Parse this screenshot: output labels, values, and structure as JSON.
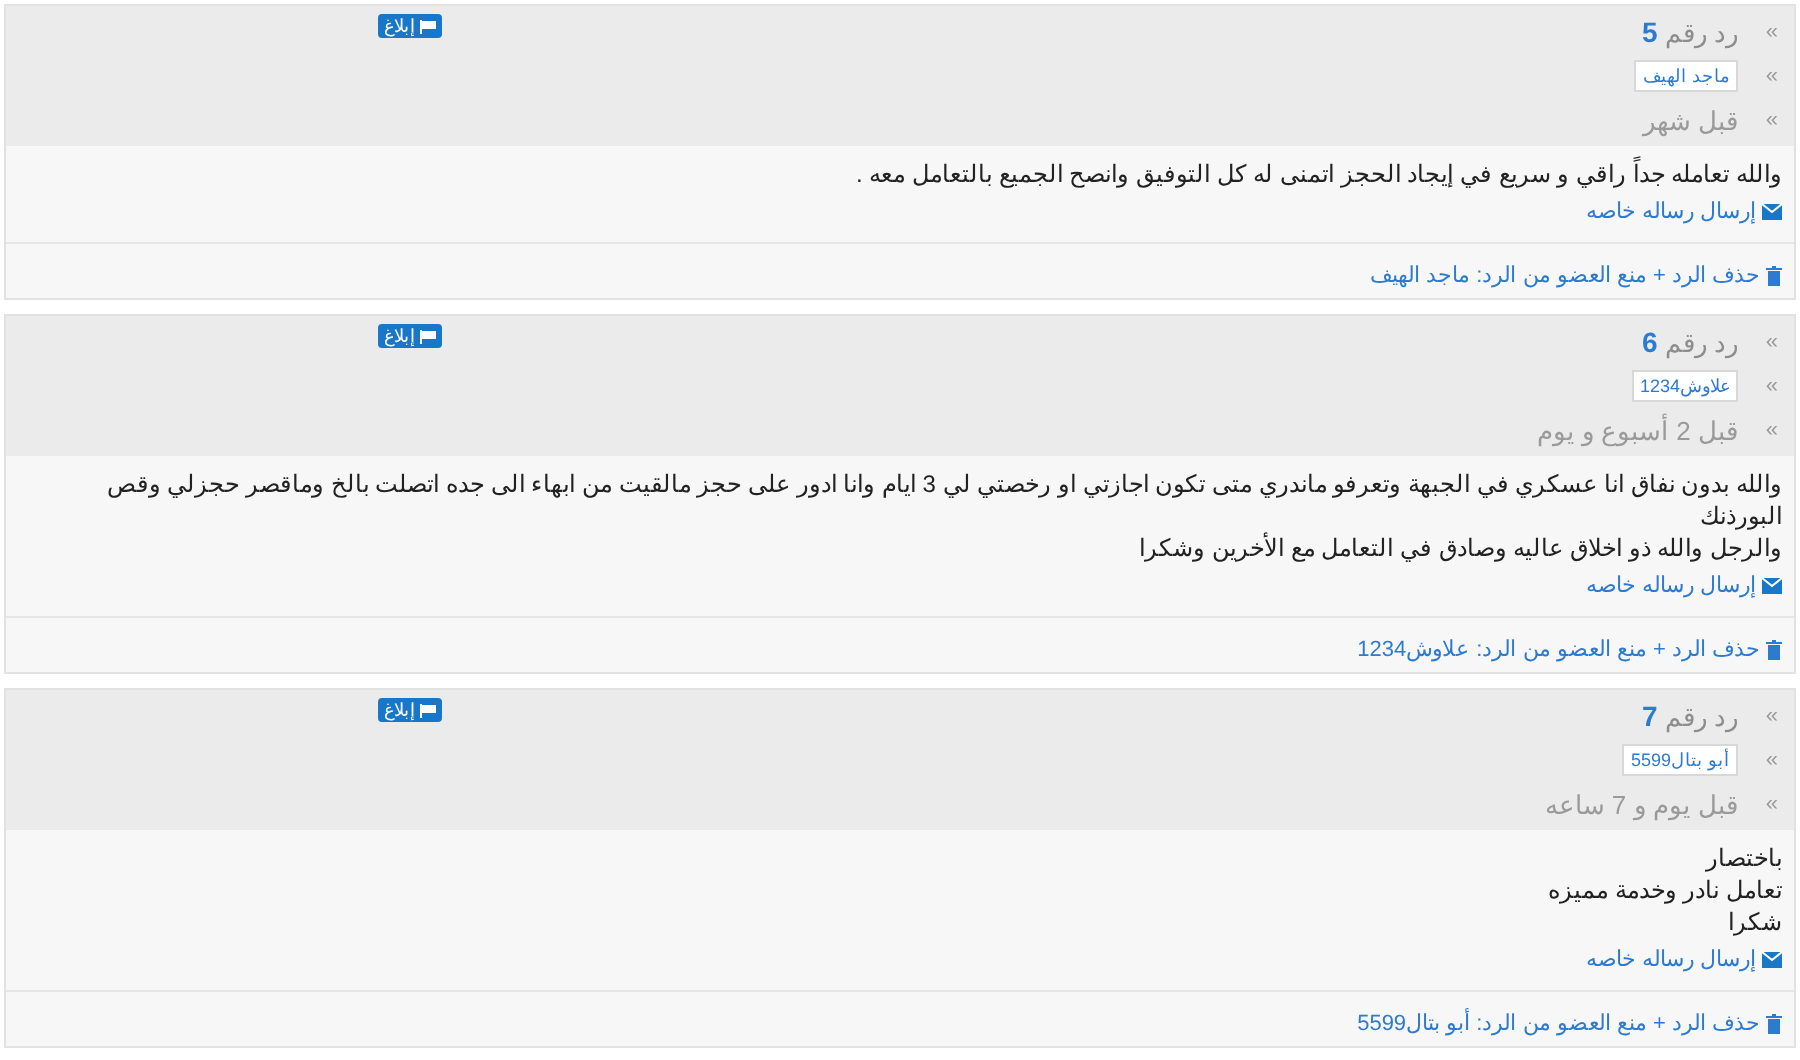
{
  "replies": [
    {
      "report": "إبلاغ",
      "marker": "»",
      "reply_label": "رد رقم",
      "number": "5",
      "author": "ماجد الهيف",
      "time": "قبل شهر",
      "body": [
        "والله تعامله جداً راقي و سريع في إيجاد الحجز اتمنى له كل التوفيق وانصح الجميع بالتعامل معه ."
      ],
      "message_link": "إرسال رساله خاصه",
      "moderation_link": "حذف الرد + منع العضو من الرد: ماجد الهيف"
    },
    {
      "report": "إبلاغ",
      "marker": "»",
      "reply_label": "رد رقم",
      "number": "6",
      "author": "علاوش1234",
      "time": "قبل 2 أسبوع و يوم",
      "body": [
        "والله بدون نفاق انا عسكري في الجبهة وتعرفو ماندري متى تكون اجازتي او رخصتي لي 3 ايام وانا ادور على حجز مالقيت من ابهاء الى جده اتصلت بالخ وماقصر حجزلي وقص البورذنك",
        "والرجل والله ذو اخلاق عاليه وصادق في التعامل مع الأخرين وشكرا"
      ],
      "message_link": "إرسال رساله خاصه",
      "moderation_link": "حذف الرد + منع العضو من الرد: علاوش1234"
    },
    {
      "report": "إبلاغ",
      "marker": "»",
      "reply_label": "رد رقم",
      "number": "7",
      "author": "أبو بتال5599",
      "time": "قبل يوم و 7 ساعه",
      "body": [
        "باختصار",
        "تعامل نادر وخدمة مميزه",
        "شكرا"
      ],
      "message_link": "إرسال رساله خاصه",
      "moderation_link": "حذف الرد + منع العضو من الرد: أبو بتال5599"
    }
  ]
}
